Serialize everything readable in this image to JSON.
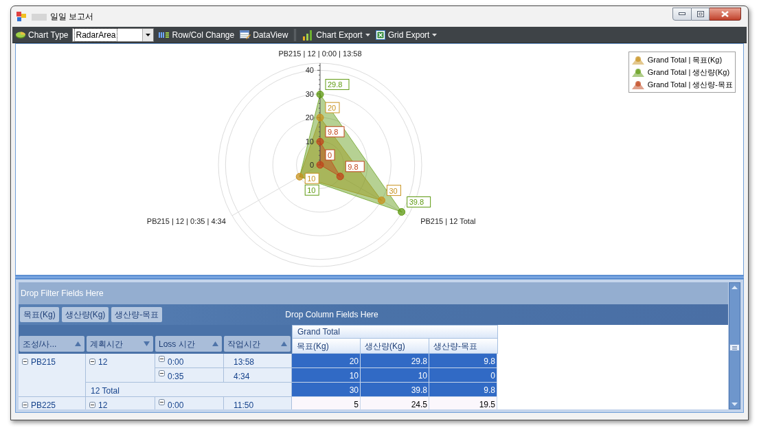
{
  "window": {
    "title": "일일 보고서"
  },
  "toolbar": {
    "items": [
      {
        "kind": "label",
        "label": "Chart Type"
      },
      {
        "kind": "select",
        "value": "RadarArea"
      },
      {
        "kind": "button",
        "label": "Row/Col Change"
      },
      {
        "kind": "button",
        "label": "DataView"
      },
      {
        "kind": "separator"
      },
      {
        "kind": "menu",
        "label": "Chart Export"
      },
      {
        "kind": "menu",
        "label": "Grid Export"
      }
    ]
  },
  "chart": {
    "radar": {
      "axis_labels": [
        "PB215 | 12 | 0:00 | 13:58",
        "PB215 | 12 | 0:35 | 4:34",
        "PB215 | 12 Total"
      ],
      "ticks": [
        "40",
        "30",
        "20",
        "10",
        "0"
      ],
      "series": [
        {
          "name": "Grand Total | 목표(Kg)",
          "color": "#c8921e",
          "point_labels": [
            "20",
            "10",
            "30"
          ]
        },
        {
          "name": "Grand Total | 생산량(Kg)",
          "color": "#5e9a10",
          "point_labels": [
            "29.8",
            "10",
            "39.8"
          ]
        },
        {
          "name": "Grand Total | 생산량-목표",
          "color": "#c0441a",
          "point_labels": [
            "9.8",
            "0",
            "9.8"
          ]
        }
      ]
    }
  },
  "pivot": {
    "filter_area": "Drop Filter Fields Here",
    "data_fields": [
      "목표(Kg)",
      "생산량(Kg)",
      "생산량-목표"
    ],
    "column_area": "Drop Column Fields Here",
    "row_fields": [
      {
        "label": "조성/사...",
        "sort_ascending": true
      },
      {
        "label": "계획시간",
        "sort_ascending": false
      },
      {
        "label": "Loss 시간",
        "sort_ascending": true
      },
      {
        "label": "작업시간",
        "sort_ascending": true
      }
    ],
    "column_header": "Grand Total",
    "measures": [
      "목표(Kg)",
      "생산량(Kg)",
      "생산량-목표"
    ],
    "rows": [
      {
        "label": "PB215",
        "expanded": true,
        "children": [
          {
            "label": "12",
            "expanded": true,
            "children": [
              {
                "label": "0:00",
                "expanded": true,
                "work_time": "13:58",
                "values": [
                  "20",
                  "29.8",
                  "9.8"
                ],
                "selected": true
              },
              {
                "label": "0:35",
                "expanded": true,
                "work_time": "4:34",
                "values": [
                  "10",
                  "10",
                  "0"
                ],
                "selected": true
              }
            ],
            "total": {
              "label": "12 Total",
              "values": [
                "30",
                "39.8",
                "9.8"
              ],
              "selected": true
            }
          }
        ]
      },
      {
        "label": "PB225",
        "expanded": true,
        "children": [
          {
            "label": "12",
            "expanded": true,
            "children": [
              {
                "label": "0:00",
                "expanded": true,
                "work_time": "11:50",
                "values": [
                  "5",
                  "24.5",
                  "19.5"
                ],
                "selected": false
              }
            ]
          }
        ]
      }
    ]
  }
}
